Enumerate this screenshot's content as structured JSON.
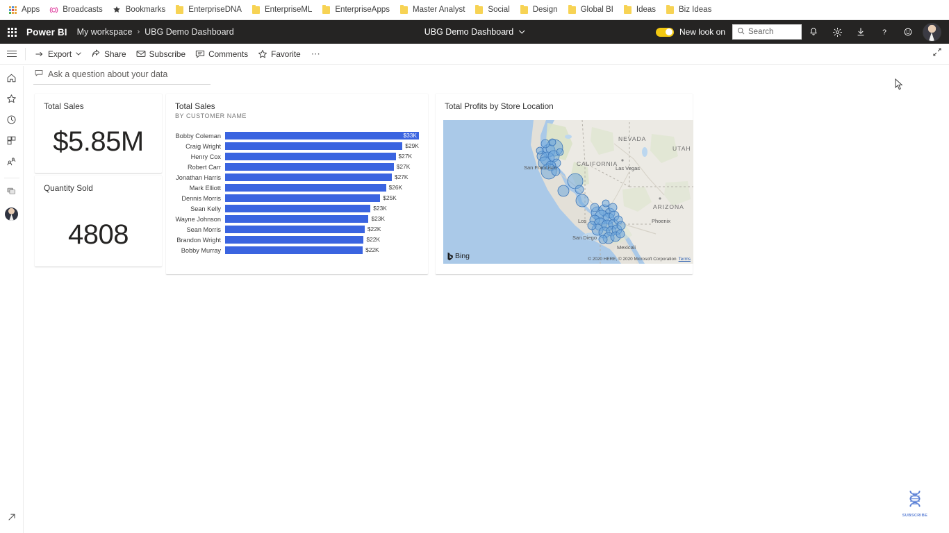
{
  "browser": {
    "bookmarks": [
      {
        "label": "Apps",
        "icon": "apps-grid-icon"
      },
      {
        "label": "Broadcasts",
        "icon": "broadcast-icon"
      },
      {
        "label": "Bookmarks",
        "icon": "star-icon"
      },
      {
        "label": "EnterpriseDNA",
        "icon": "folder-icon"
      },
      {
        "label": "EnterpriseML",
        "icon": "folder-icon"
      },
      {
        "label": "EnterpriseApps",
        "icon": "folder-icon"
      },
      {
        "label": "Master Analyst",
        "icon": "folder-icon"
      },
      {
        "label": "Social",
        "icon": "folder-icon"
      },
      {
        "label": "Design",
        "icon": "folder-icon"
      },
      {
        "label": "Global BI",
        "icon": "folder-icon"
      },
      {
        "label": "Ideas",
        "icon": "folder-icon"
      },
      {
        "label": "Biz Ideas",
        "icon": "folder-icon"
      }
    ]
  },
  "header": {
    "brand": "Power BI",
    "breadcrumb": {
      "workspace": "My workspace",
      "separator": "›",
      "current": "UBG Demo Dashboard"
    },
    "center_title": "UBG Demo Dashboard",
    "center_chevron": "⌄",
    "new_look_label": "New look on",
    "new_look_on": true,
    "search_placeholder": "Search",
    "icons": [
      "notifications-bell-icon",
      "settings-gear-icon",
      "download-icon",
      "help-question-icon",
      "feedback-smiley-icon"
    ],
    "accent_yellow": "#f2c811",
    "bar_color": "#252423"
  },
  "toolbar": {
    "items": [
      {
        "label": "Export",
        "icon": "export-icon",
        "has_chevron": true
      },
      {
        "label": "Share",
        "icon": "share-icon",
        "has_chevron": false
      },
      {
        "label": "Subscribe",
        "icon": "envelope-icon",
        "has_chevron": false
      },
      {
        "label": "Comments",
        "icon": "comment-icon",
        "has_chevron": false
      },
      {
        "label": "Favorite",
        "icon": "star-outline-icon",
        "has_chevron": false
      }
    ],
    "overflow": "⋯",
    "expand_icon": "expand-diagonal-icon"
  },
  "qna": {
    "placeholder": "Ask a question about your data",
    "icon": "chat-bubble-icon"
  },
  "rail": {
    "items": [
      {
        "name": "home-icon",
        "label": "Home"
      },
      {
        "name": "favorites-star-icon",
        "label": "Favorites"
      },
      {
        "name": "recent-clock-icon",
        "label": "Recent"
      },
      {
        "name": "apps-layout-icon",
        "label": "Apps"
      },
      {
        "name": "shared-people-icon",
        "label": "Shared with me"
      },
      {
        "name": "workspaces-icon",
        "label": "Workspaces"
      },
      {
        "name": "my-workspace-avatar",
        "label": "My workspace"
      }
    ],
    "bottom_icon": "collapse-arrow-icon"
  },
  "tiles": {
    "total_sales": {
      "title": "Total Sales",
      "value": "$5.85M"
    },
    "quantity_sold": {
      "title": "Quantity Sold",
      "value": "4808"
    },
    "bar_chart": {
      "title": "Total Sales",
      "subtitle": "BY CUSTOMER NAME"
    },
    "map": {
      "title": "Total Profits by Store Location",
      "bing_label": "Bing",
      "attribution": "© 2020 HERE, © 2020 Microsoft Corporation",
      "terms_label": "Terms",
      "labels": [
        "NEVADA",
        "UTAH",
        "CALIFORNIA",
        "ARIZONA",
        "Las Vegas",
        "Phoenix",
        "San Francisco",
        "Los",
        "San Diego",
        "Mexicali"
      ]
    }
  },
  "chart_data": {
    "type": "bar",
    "title": "Total Sales",
    "subtitle": "BY CUSTOMER NAME",
    "xlabel": "",
    "ylabel": "Customer Name",
    "orientation": "horizontal",
    "bar_color": "#3a64e0",
    "categories": [
      "Bobby Coleman",
      "Craig Wright",
      "Henry Cox",
      "Robert Carr",
      "Jonathan Harris",
      "Mark Elliott",
      "Dennis Morris",
      "Sean Kelly",
      "Wayne Johnson",
      "Sean Morris",
      "Brandon Wright",
      "Bobby Murray"
    ],
    "values": [
      33,
      29,
      27,
      27,
      27,
      26,
      25,
      23,
      23,
      22,
      22,
      22
    ],
    "value_labels": [
      "$33K",
      "$29K",
      "$27K",
      "$27K",
      "$27K",
      "$26K",
      "$25K",
      "$23K",
      "$23K",
      "$22K",
      "$22K",
      "$22K"
    ],
    "bar_pct": [
      100,
      91.5,
      88.0,
      87.0,
      86.0,
      83.0,
      80.0,
      75.0,
      74.0,
      72.0,
      71.5,
      71.0
    ],
    "label_inside": [
      true,
      false,
      false,
      false,
      false,
      false,
      false,
      false,
      false,
      false,
      false,
      false
    ],
    "xlim": [
      0,
      33
    ]
  },
  "watermark": {
    "label": "SUBSCRIBE",
    "icon": "dna-helix-icon",
    "color": "#5b7fd4"
  }
}
